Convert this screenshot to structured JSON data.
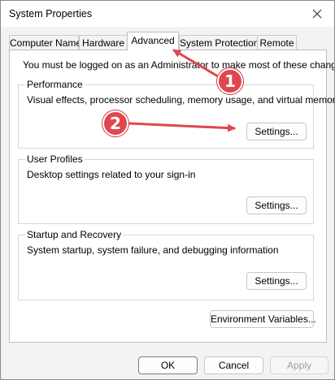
{
  "window": {
    "title": "System Properties"
  },
  "tabs": [
    {
      "label": "Computer Name",
      "active": false
    },
    {
      "label": "Hardware",
      "active": false
    },
    {
      "label": "Advanced",
      "active": true
    },
    {
      "label": "System Protection",
      "active": false
    },
    {
      "label": "Remote",
      "active": false
    }
  ],
  "advanced": {
    "admin_note": "You must be logged on as an Administrator to make most of these changes.",
    "performance": {
      "title": "Performance",
      "description": "Visual effects, processor scheduling, memory usage, and virtual memory",
      "button": "Settings..."
    },
    "user_profiles": {
      "title": "User Profiles",
      "description": "Desktop settings related to your sign-in",
      "button": "Settings..."
    },
    "startup_recovery": {
      "title": "Startup and Recovery",
      "description": "System startup, system failure, and debugging information",
      "button": "Settings..."
    },
    "env_button": "Environment Variables..."
  },
  "footer": {
    "ok": "OK",
    "cancel": "Cancel",
    "apply": "Apply"
  },
  "annotations": {
    "badge1": "1",
    "badge2": "2",
    "color": "#e0474d"
  },
  "icons": {
    "close": "close-icon"
  }
}
